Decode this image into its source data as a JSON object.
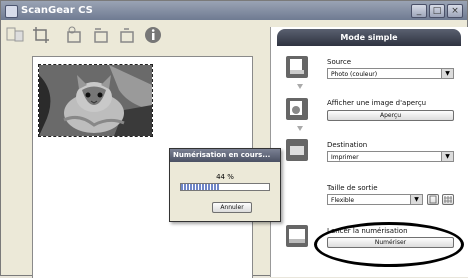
{
  "window": {
    "title": "ScanGear CS"
  },
  "tab": {
    "label": "Mode simple"
  },
  "source": {
    "label": "Source",
    "value": "Photo (couleur)"
  },
  "preview_step": {
    "label": "Afficher une image d'aperçu",
    "button": "Aperçu"
  },
  "destination": {
    "label": "Destination",
    "value": "Imprimer"
  },
  "output_size": {
    "label": "Taille de sortie",
    "value": "Flexible"
  },
  "scan_step": {
    "label": "Lancer la numérisation",
    "button": "Numériser"
  },
  "dialog": {
    "title": "Numérisation en cours...",
    "percent_text": "44 %",
    "progress": 0.44,
    "cancel": "Annuler"
  }
}
